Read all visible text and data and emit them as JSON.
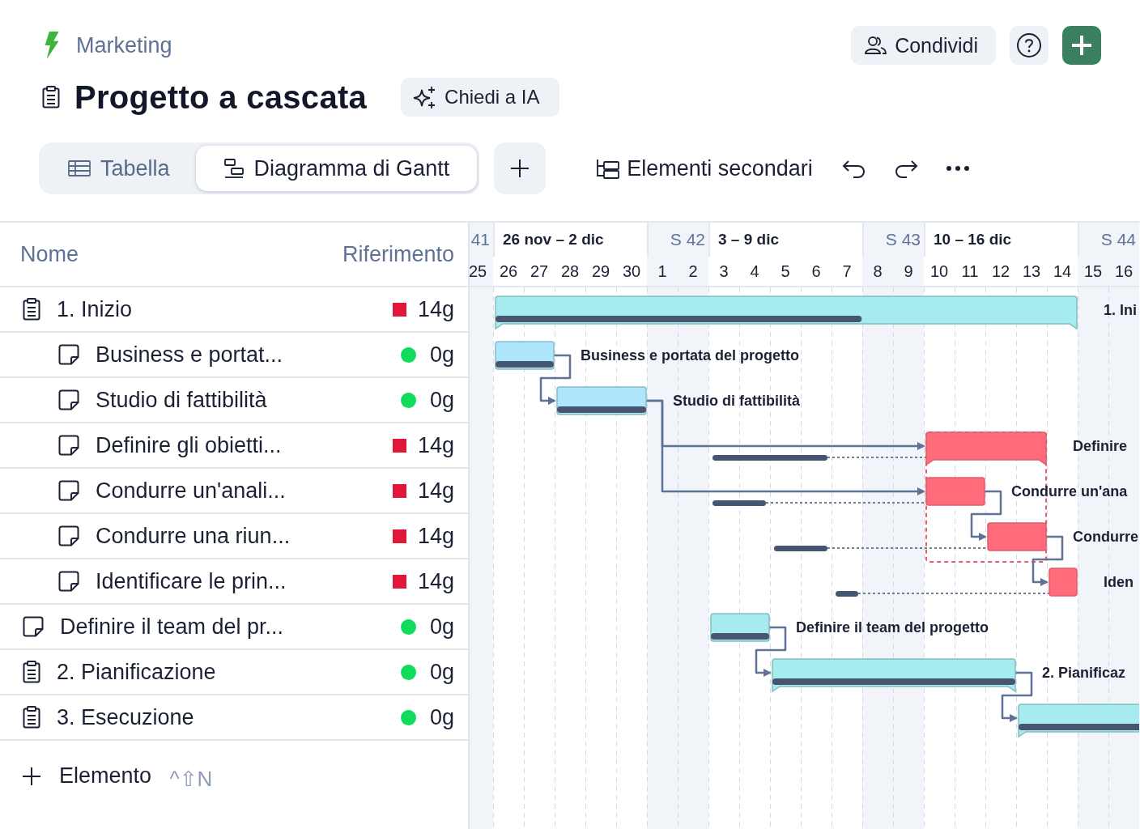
{
  "breadcrumb": "Marketing",
  "title": "Progetto a cascata",
  "ai_button": "Chiedi a IA",
  "share_button": "Condividi",
  "views": [
    {
      "label": "Tabella",
      "kind": "table",
      "selected": false
    },
    {
      "label": "Diagramma di Gantt",
      "kind": "gantt",
      "selected": true
    }
  ],
  "subitems_button": "Elementi secondari",
  "table": {
    "columns": [
      "Nome",
      "Riferimento"
    ],
    "rows": [
      {
        "name": "1. Inizio",
        "kind": "group",
        "overdue": true,
        "reference": "14g",
        "bar": {
          "kind": "summary",
          "color": "#a6ecef",
          "level": 0.63,
          "label": "1. Ini",
          "arrow_in": false
        },
        "children": [
          {
            "name": "Business e portat...",
            "kind": "task",
            "overdue": false,
            "reference": "0g",
            "bar": {
              "kind": "task",
              "color": "#aee6fb",
              "level": 1,
              "label": "Business e portata del progetto",
              "arrow_in": false
            }
          },
          {
            "name": "Studio di fattibilità",
            "kind": "task",
            "overdue": false,
            "reference": "0g",
            "bar": {
              "kind": "task",
              "color": "#aee6fb",
              "level": 1,
              "label": "Studio di fattibilità",
              "arrow_in": true
            }
          },
          {
            "name": "Definire gli obietti...",
            "kind": "task",
            "overdue": true,
            "reference": "14g",
            "bar": {
              "kind": "summary",
              "color": "#ff6b7b",
              "outlined": true,
              "baseline": true,
              "label": "Definire",
              "arrow_in": true
            }
          },
          {
            "name": "Condurre un'anali...",
            "kind": "task",
            "overdue": true,
            "reference": "14g",
            "bar": {
              "kind": "task",
              "color": "#ff6b7b",
              "baseline": true,
              "label": "Condurre un'ana",
              "arrow_in": true
            }
          },
          {
            "name": "Condurre una riun...",
            "kind": "task",
            "overdue": true,
            "reference": "14g",
            "bar": {
              "kind": "task",
              "color": "#ff6b7b",
              "baseline": true,
              "label": "Condurre",
              "arrow_in": true
            }
          },
          {
            "name": "Identificare le prin...",
            "kind": "task",
            "overdue": true,
            "reference": "14g",
            "bar": {
              "kind": "task",
              "color": "#ff6b7b",
              "baseline": true,
              "label": "Iden",
              "arrow_in": true
            }
          }
        ]
      },
      {
        "name": "Definire il team del pr...",
        "kind": "task",
        "overdue": false,
        "reference": "0g",
        "bar": {
          "kind": "task",
          "color": "#a6ecef",
          "level": 1,
          "label": "Definire il team del progetto",
          "arrow_in": false
        }
      },
      {
        "name": "2. Pianificazione",
        "kind": "group",
        "overdue": false,
        "reference": "0g",
        "bar": {
          "kind": "summary",
          "color": "#a6ecef",
          "level": 1,
          "label": "2. Pianificaz",
          "arrow_in": true
        }
      },
      {
        "name": "3. Esecuzione",
        "kind": "group",
        "overdue": false,
        "reference": "0g",
        "bar": {
          "kind": "summary",
          "color": "#a6ecef",
          "level": 1,
          "arrow_in": true
        }
      }
    ]
  },
  "add_item": {
    "label": "Elemento",
    "shortcut": "^⇧N"
  },
  "timeline": {
    "weeks": [
      "41",
      "26 nov – 2 dic",
      "S 42",
      "3 – 9 dic",
      "S 43",
      "10 – 16 dic",
      "S 44"
    ],
    "days": [
      {
        "label": "25",
        "weekend": true
      },
      {
        "label": "26",
        "weekend": false
      },
      {
        "label": "27",
        "weekend": false
      },
      {
        "label": "28",
        "weekend": false
      },
      {
        "label": "29",
        "weekend": false
      },
      {
        "label": "30",
        "weekend": false
      },
      {
        "label": "1",
        "weekend": true
      },
      {
        "label": "2",
        "weekend": true
      },
      {
        "label": "3",
        "weekend": false
      },
      {
        "label": "4",
        "weekend": false
      },
      {
        "label": "5",
        "weekend": false
      },
      {
        "label": "6",
        "weekend": false
      },
      {
        "label": "7",
        "weekend": false
      },
      {
        "label": "8",
        "weekend": true
      },
      {
        "label": "9",
        "weekend": true
      },
      {
        "label": "10",
        "weekend": false
      },
      {
        "label": "11",
        "weekend": false
      },
      {
        "label": "12",
        "weekend": false
      },
      {
        "label": "13",
        "weekend": false
      },
      {
        "label": "14",
        "weekend": false
      },
      {
        "label": "15",
        "weekend": true
      },
      {
        "label": "16",
        "weekend": true
      }
    ]
  }
}
